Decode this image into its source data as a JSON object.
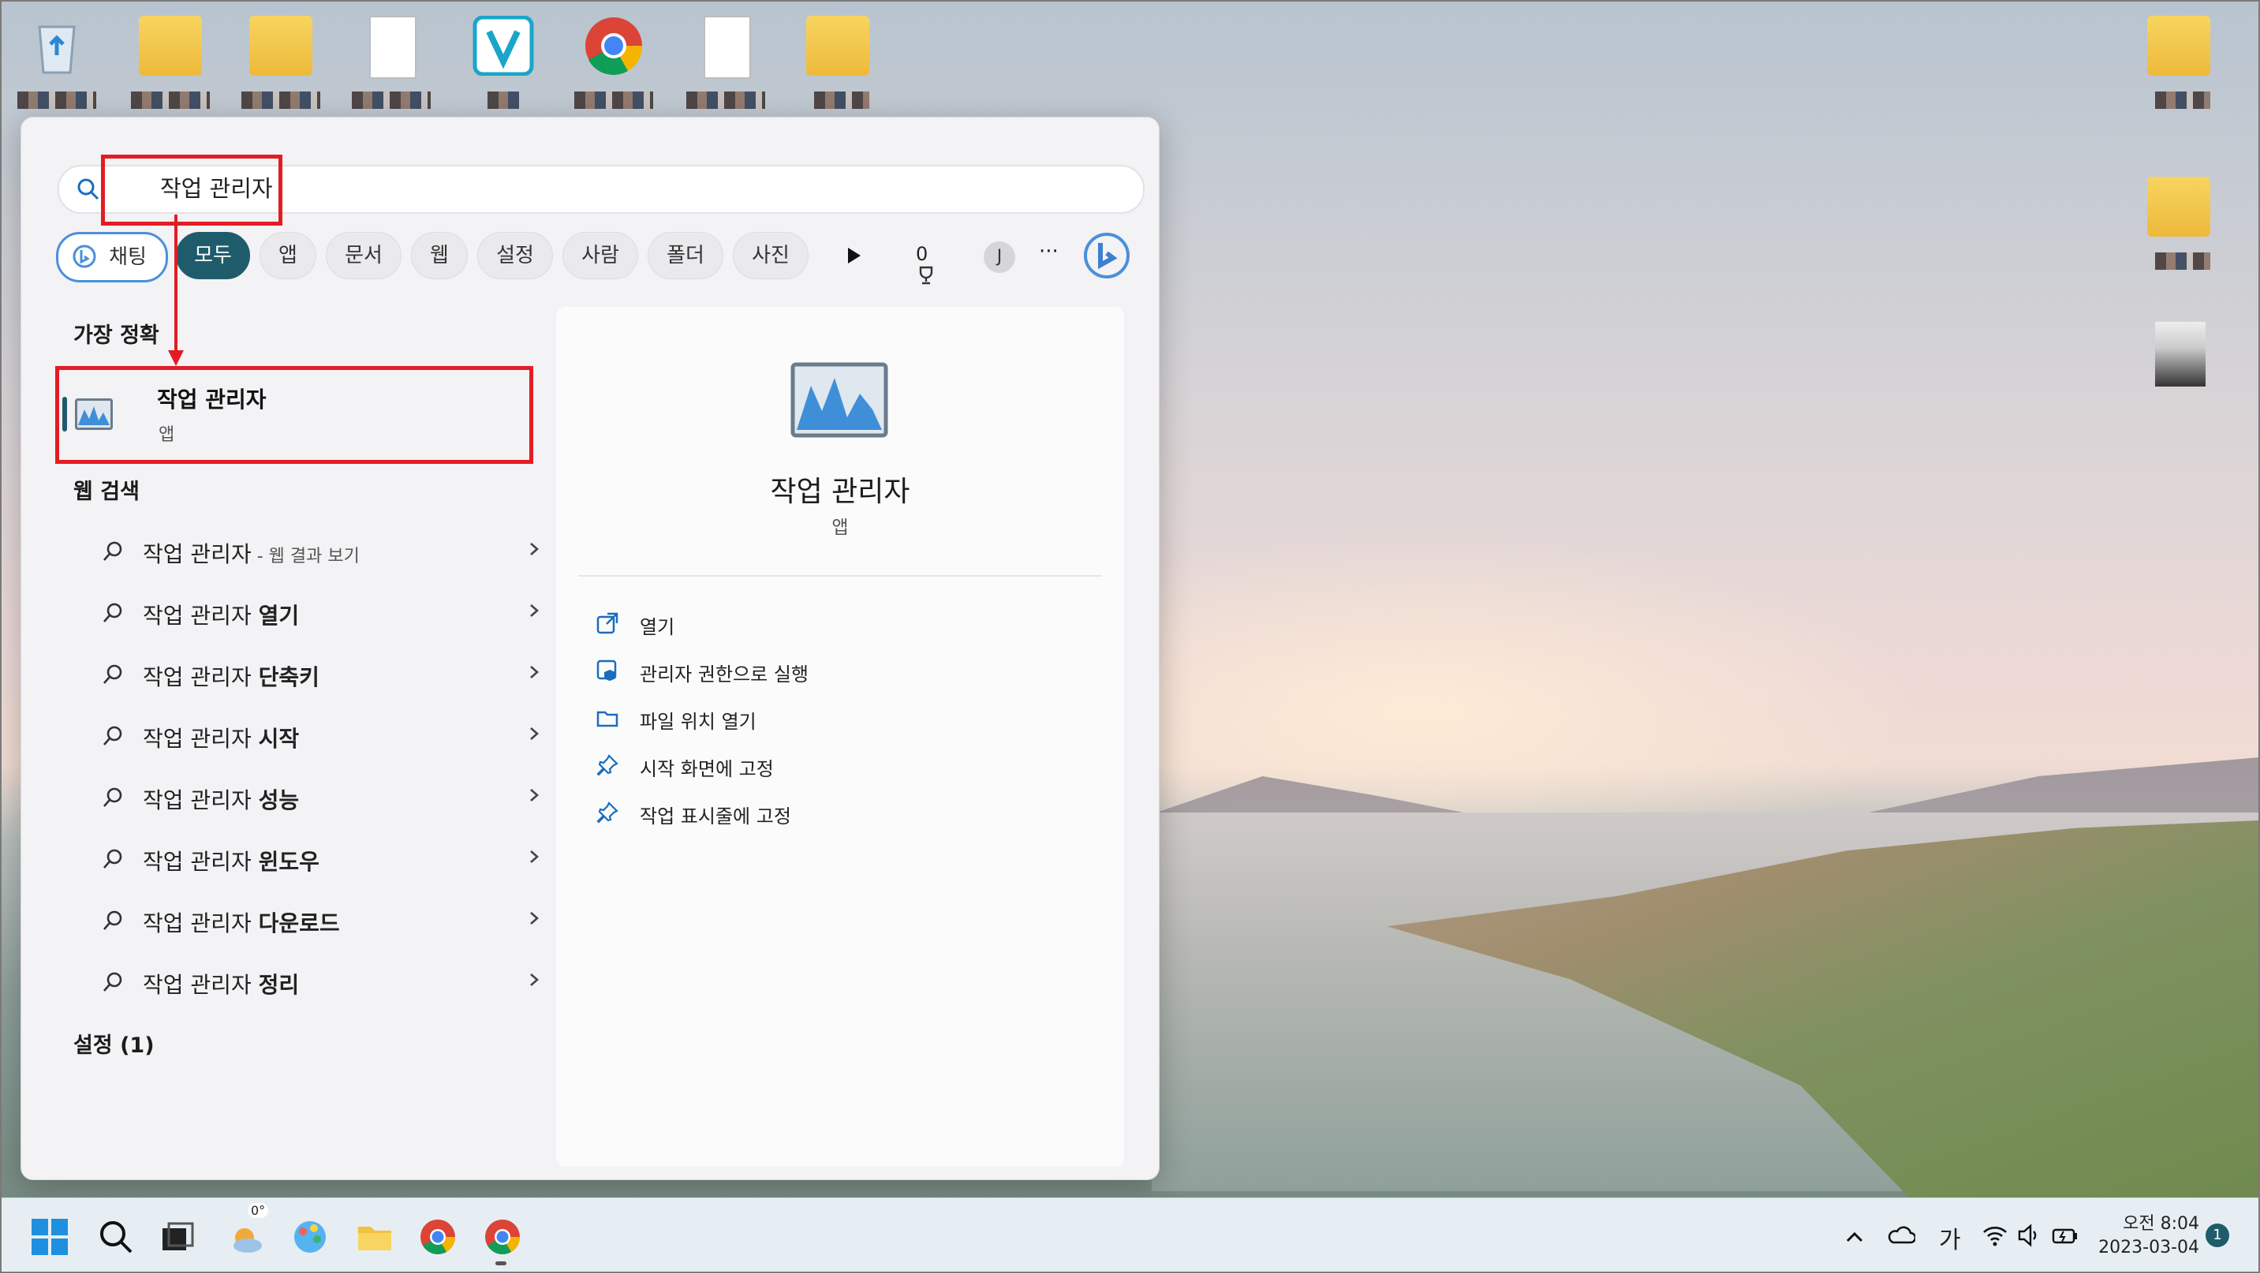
{
  "search": {
    "query": "작업 관리자"
  },
  "filters": [
    {
      "label": "채팅"
    },
    {
      "label": "모두"
    },
    {
      "label": "앱"
    },
    {
      "label": "문서"
    },
    {
      "label": "웹"
    },
    {
      "label": "설정"
    },
    {
      "label": "사람"
    },
    {
      "label": "폴더"
    },
    {
      "label": "사진"
    }
  ],
  "rewards": {
    "points": "0",
    "avatar_letter": "J",
    "more": "···"
  },
  "best_match": {
    "section_title": "가장 정확",
    "name": "작업 관리자",
    "type": "앱"
  },
  "web_search": {
    "section_title": "웹 검색",
    "items": [
      {
        "prefix": "작업 관리자",
        "bold": "",
        "suffix": " - 웹 결과 보기"
      },
      {
        "prefix": "작업 관리자 ",
        "bold": "열기",
        "suffix": ""
      },
      {
        "prefix": "작업 관리자 ",
        "bold": "단축키",
        "suffix": ""
      },
      {
        "prefix": "작업 관리자 ",
        "bold": "시작",
        "suffix": ""
      },
      {
        "prefix": "작업 관리자 ",
        "bold": "성능",
        "suffix": ""
      },
      {
        "prefix": "작업 관리자 ",
        "bold": "윈도우",
        "suffix": ""
      },
      {
        "prefix": "작업 관리자 ",
        "bold": "다운로드",
        "suffix": ""
      },
      {
        "prefix": "작업 관리자 ",
        "bold": "정리",
        "suffix": ""
      }
    ]
  },
  "settings_section": {
    "title": "설정 (1)"
  },
  "preview": {
    "name": "작업 관리자",
    "type": "앱",
    "actions": [
      {
        "label": "열기",
        "icon": "open-external-icon"
      },
      {
        "label": "관리자 권한으로 실행",
        "icon": "shield-icon"
      },
      {
        "label": "파일 위치 열기",
        "icon": "folder-icon"
      },
      {
        "label": "시작 화면에 고정",
        "icon": "pin-icon"
      },
      {
        "label": "작업 표시줄에 고정",
        "icon": "pin-icon"
      }
    ]
  },
  "taskbar": {
    "weather_temp": "0°",
    "ime_label": "가",
    "time": "오전 8:04",
    "date": "2023-03-04",
    "notification_count": "1"
  },
  "colors": {
    "accent": "#1f5c6b",
    "annotation": "#e31c24",
    "bing": "#4a90d9"
  }
}
